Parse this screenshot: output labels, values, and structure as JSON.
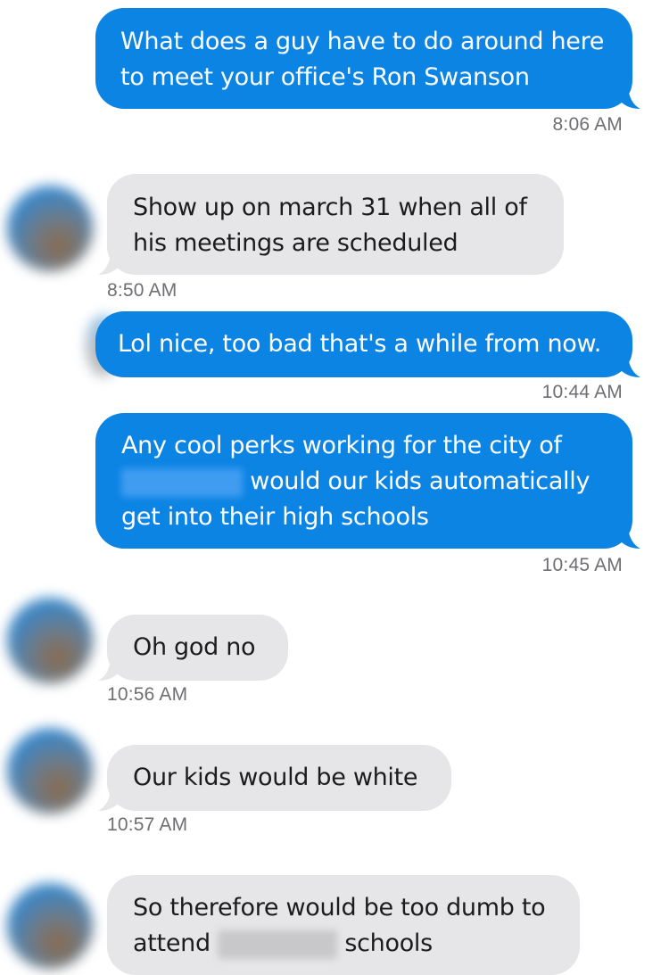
{
  "messages": [
    {
      "direction": "outgoing",
      "lines": [
        "What does a guy have to do around here",
        "to meet your office's Ron Swanson"
      ],
      "time": "8:06 AM"
    },
    {
      "direction": "incoming",
      "lines": [
        "Show up on march 31 when all of",
        "his meetings are scheduled"
      ],
      "time": "8:50 AM"
    },
    {
      "direction": "outgoing",
      "lines": [
        "Lol nice, too bad that's a while from now."
      ],
      "time": "10:44 AM"
    },
    {
      "direction": "outgoing",
      "lines": [
        "Any cool perks working for the city of",
        "would our kids automatically",
        "get into their high schools"
      ],
      "time": "10:45 AM"
    },
    {
      "direction": "incoming",
      "lines": [
        "Oh god no"
      ],
      "time": "10:56 AM"
    },
    {
      "direction": "incoming",
      "lines": [
        "Our kids would be white"
      ],
      "time": "10:57 AM"
    },
    {
      "direction": "incoming",
      "lines": [
        "So therefore would be too dumb to",
        "attend",
        "schools"
      ]
    }
  ],
  "colors": {
    "outgoing_bubble": "#0c84e4",
    "incoming_bubble": "#e6e6e8",
    "timestamp": "#6e6e73"
  }
}
